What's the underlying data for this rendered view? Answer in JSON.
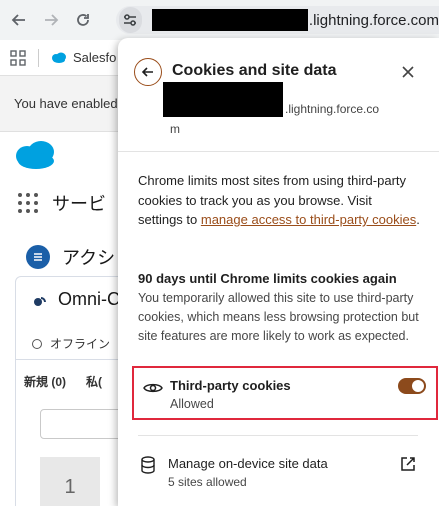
{
  "browser": {
    "url_suffix": ".lightning.force.com",
    "bookmark_label": "Salesfo",
    "notice_text": "You have enabled",
    "colors": {
      "toolbar": "#f1f3f4",
      "accent": "#9a4d1a"
    }
  },
  "page": {
    "app_name": "サービ",
    "action_label": "アクシ",
    "omni_title": "Omni-C",
    "offline_label": "オフライン",
    "new_label": "新規 (0)",
    "mine_label": "私(",
    "number_box": "1"
  },
  "popup": {
    "title": "Cookies and site data",
    "origin_suffix_1": ".lightning.force.co",
    "origin_suffix_2": "m",
    "description": "Chrome limits most sites from using third-party cookies to track you as you browse. Visit settings to ",
    "description_link": "manage access to third-party cookies",
    "description_end": ".",
    "limit_title": "90 days until Chrome limits cookies again",
    "limit_body": "You temporarily allowed this site to use third-party cookies, which means less browsing protection but site features are more likely to work as expected.",
    "third_party": {
      "label": "Third-party cookies",
      "status": "Allowed",
      "enabled": true,
      "highlight_color": "#e0283c"
    },
    "manage_data": {
      "label": "Manage on-device site data",
      "status": "5 sites allowed"
    }
  }
}
